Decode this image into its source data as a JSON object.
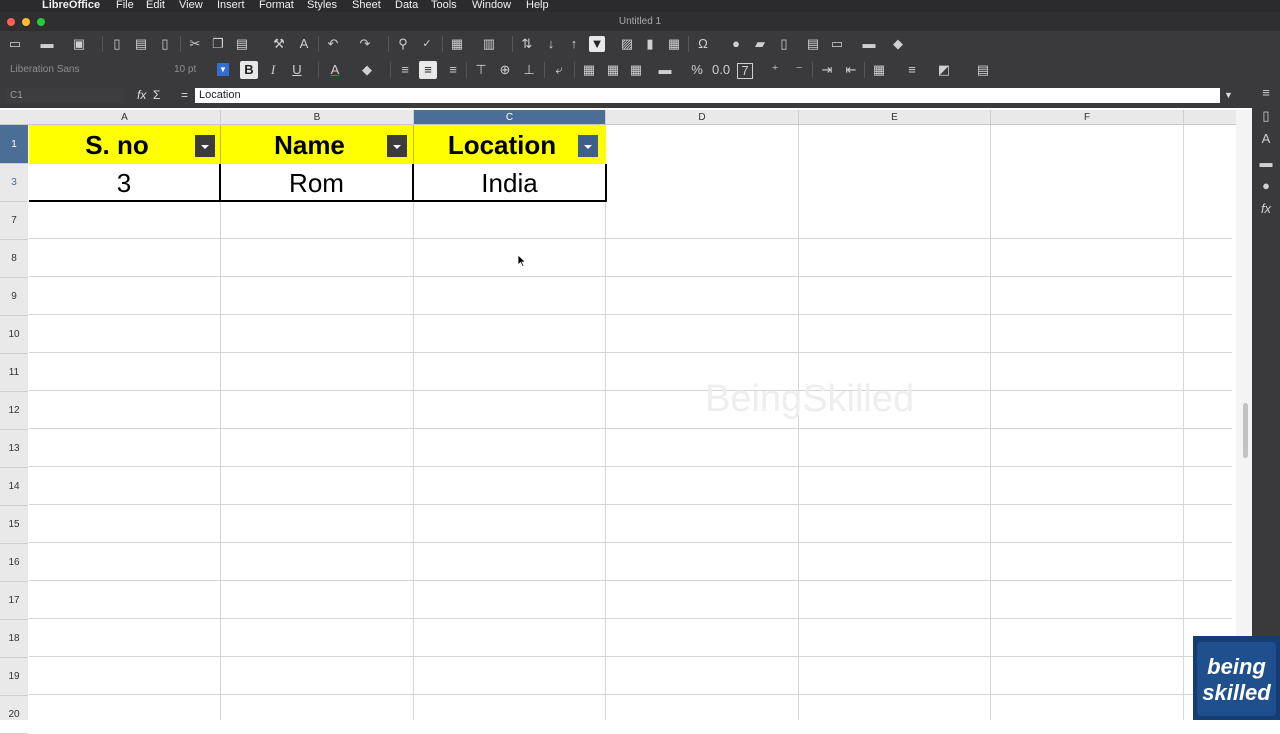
{
  "menubar": {
    "app_name": "LibreOffice",
    "items": [
      "File",
      "Edit",
      "View",
      "Insert",
      "Format",
      "Styles",
      "Sheet",
      "Data",
      "Tools",
      "Window",
      "Help"
    ]
  },
  "window": {
    "title": "Untitled 1"
  },
  "formatting": {
    "font_name": "Liberation Sans",
    "font_size": "10 pt"
  },
  "formula_bar": {
    "name_box": "C1",
    "content": "Location"
  },
  "columns": [
    "A",
    "B",
    "C",
    "D",
    "E",
    "F"
  ],
  "rows": [
    "1",
    "3",
    "7",
    "8",
    "9",
    "10",
    "11",
    "12",
    "13",
    "14",
    "15",
    "16",
    "17",
    "18",
    "19",
    "20"
  ],
  "table": {
    "headers": [
      "S. no",
      "Name",
      "Location"
    ],
    "row": [
      "3",
      "Rom",
      "India"
    ]
  },
  "watermark": "BeingSkilled",
  "logo": {
    "line1": "being",
    "line2": "skilled"
  },
  "colors": {
    "header_fill": "#ffff00",
    "selection": "#4a6e95",
    "toolbar": "#3a3a3c"
  }
}
